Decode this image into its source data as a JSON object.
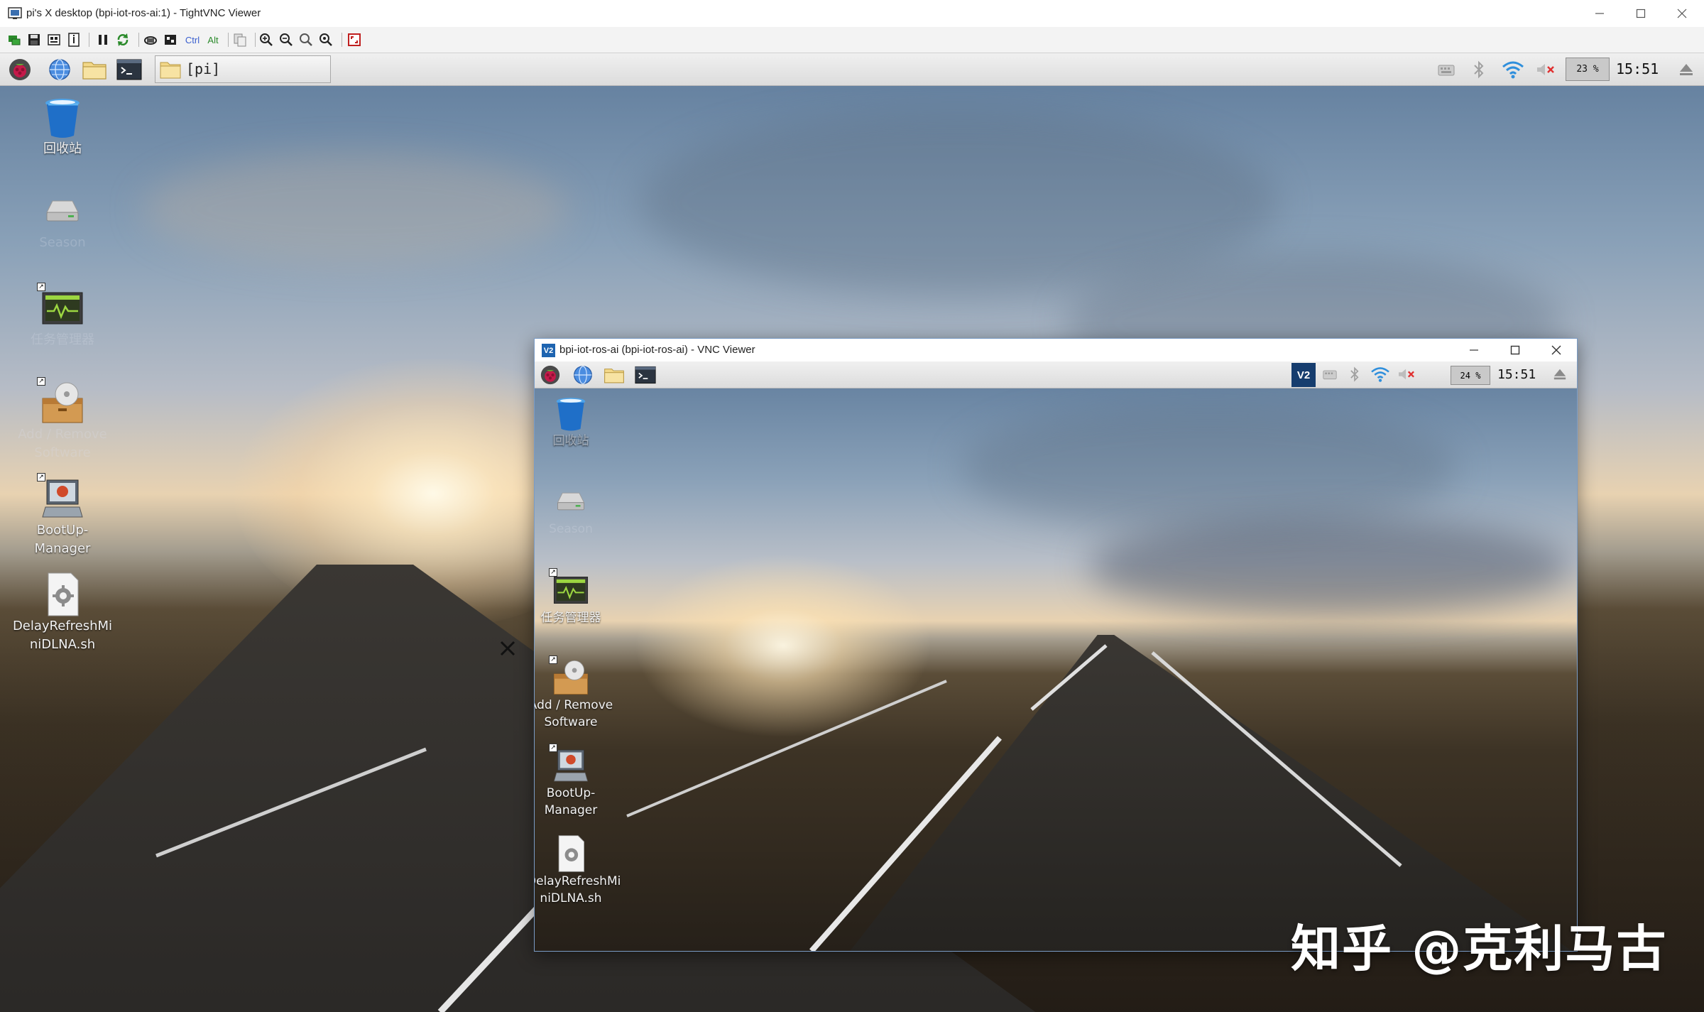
{
  "window": {
    "title": "pi's X desktop (bpi-iot-ros-ai:1) - TightVNC Viewer",
    "controls": [
      "minimize",
      "maximize",
      "close"
    ]
  },
  "toolbar": {
    "ctrl_label": "Ctrl",
    "alt_label": "Alt",
    "icons": [
      "new-connection-icon",
      "save-icon",
      "options-icon",
      "info-icon",
      "pause-icon",
      "refresh-icon",
      "send-ctrl-alt-del-icon",
      "send-ctrl-esc-icon",
      "ctrl-key-icon",
      "alt-key-icon",
      "transfer-files-icon",
      "zoom-in-icon",
      "zoom-out-icon",
      "zoom-100-icon",
      "zoom-auto-icon",
      "fullscreen-icon"
    ]
  },
  "panel": {
    "task_button_label": "[pi]",
    "cpu": "23 %",
    "clock": "15:51"
  },
  "desktop": {
    "icons": [
      {
        "label": "回收站",
        "faded": false
      },
      {
        "label": "Season",
        "faded": true
      },
      {
        "label": "任务管理器",
        "faded": true
      },
      {
        "label": "Add / Remove\nSoftware",
        "faded": true
      },
      {
        "label": "BootUp-\nManager",
        "faded": false
      },
      {
        "label": "DelayRefreshMi\nniDLNA.sh",
        "faded": false
      }
    ]
  },
  "inner_window": {
    "title": "bpi-iot-ros-ai (bpi-iot-ros-ai) - VNC Viewer",
    "logo": "V2",
    "cpu": "24 %",
    "clock": "15:51",
    "icons": [
      {
        "label": "回收站",
        "faded": false
      },
      {
        "label": "Season",
        "faded": true
      },
      {
        "label": "任务管理器",
        "faded": false
      },
      {
        "label": "Add / Remove\nSoftware",
        "faded": false
      },
      {
        "label": "BootUp-\nManager",
        "faded": false
      },
      {
        "label": "DelayRefreshMi\nniDLNA.sh",
        "faded": false
      }
    ]
  },
  "watermark": "知乎 @克利马古",
  "colors": {
    "accent_blue": "#1e64b0",
    "panel_bg": "#e6e6e6",
    "sky_top": "#5f7c9c",
    "sun": "#ffe6b8"
  }
}
